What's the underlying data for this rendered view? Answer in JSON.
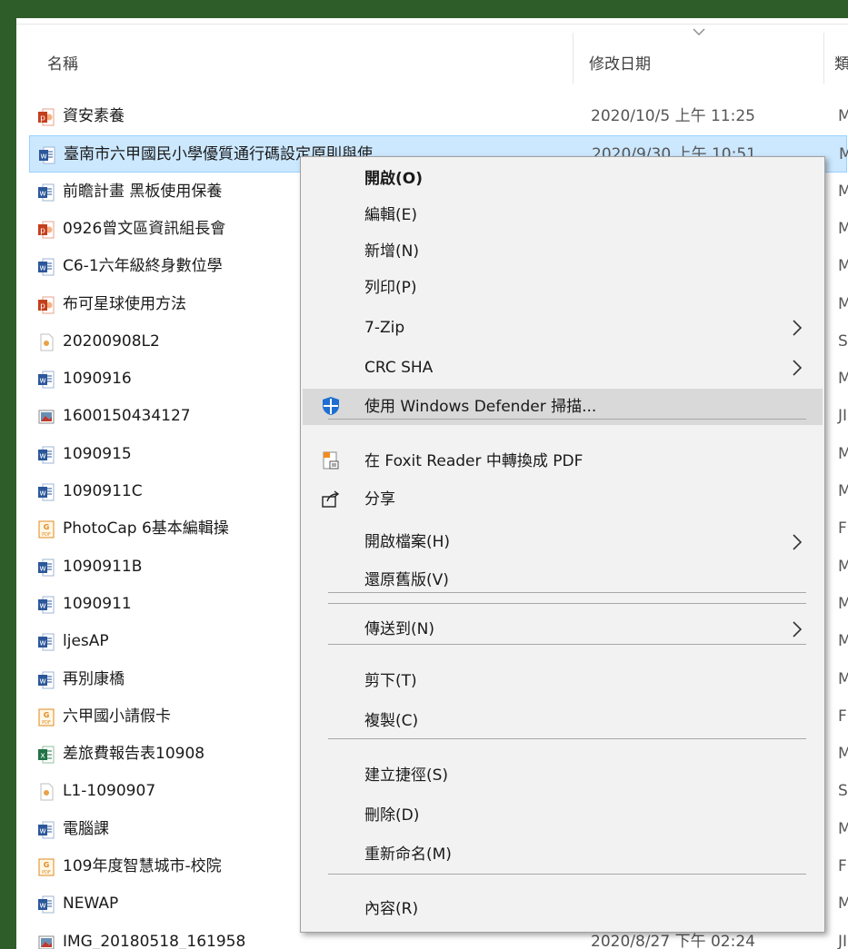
{
  "columns": {
    "name": "名稱",
    "modified": "修改日期",
    "type": "類"
  },
  "files": [
    {
      "name": "資安素養",
      "date": "2020/10/5 上午 11:25",
      "type": "M",
      "icon": "ppt-icon"
    },
    {
      "name": "臺南市六甲國民小學優質通行碼設定原則與使",
      "date": "2020/9/30 上午 10:51",
      "type": "M",
      "icon": "word-icon",
      "selected": true
    },
    {
      "name": "前瞻計畫 黑板使用保養",
      "date": "",
      "type": "M",
      "icon": "word-icon"
    },
    {
      "name": "0926曾文區資訊組長會",
      "date": "",
      "type": "M",
      "icon": "ppt-icon"
    },
    {
      "name": "C6-1六年級終身數位學",
      "date": "",
      "type": "M",
      "icon": "word-icon"
    },
    {
      "name": "布可星球使用方法",
      "date": "",
      "type": "M",
      "icon": "ppt-icon"
    },
    {
      "name": "20200908L2",
      "date": "",
      "type": "S",
      "icon": "generic-file-icon"
    },
    {
      "name": "1090916",
      "date": "",
      "type": "M",
      "icon": "word-icon"
    },
    {
      "name": "1600150434127",
      "date": "",
      "type": "JI",
      "icon": "image-icon"
    },
    {
      "name": "1090915",
      "date": "",
      "type": "M",
      "icon": "word-icon"
    },
    {
      "name": "1090911C",
      "date": "",
      "type": "M",
      "icon": "word-icon"
    },
    {
      "name": "PhotoCap 6基本編輯操",
      "date": "",
      "type": "F",
      "icon": "pdf-icon"
    },
    {
      "name": "1090911B",
      "date": "",
      "type": "M",
      "icon": "word-icon"
    },
    {
      "name": "1090911",
      "date": "",
      "type": "M",
      "icon": "word-icon"
    },
    {
      "name": "ljesAP",
      "date": "",
      "type": "M",
      "icon": "word-icon"
    },
    {
      "name": "再別康橋",
      "date": "",
      "type": "M",
      "icon": "word-icon"
    },
    {
      "name": "六甲國小請假卡",
      "date": "",
      "type": "F",
      "icon": "pdf-icon"
    },
    {
      "name": "差旅費報告表10908",
      "date": "",
      "type": "M",
      "icon": "excel-icon"
    },
    {
      "name": "L1-1090907",
      "date": "",
      "type": "S",
      "icon": "generic-file-icon"
    },
    {
      "name": "電腦課",
      "date": "",
      "type": "M",
      "icon": "word-icon"
    },
    {
      "name": "109年度智慧城市-校院",
      "date": "",
      "type": "F",
      "icon": "pdf-icon"
    },
    {
      "name": "NEWAP",
      "date": "",
      "type": "M",
      "icon": "word-icon"
    },
    {
      "name": "IMG_20180518_161958",
      "date": "2020/8/27 下午 02:24",
      "type": "JI",
      "icon": "image-icon"
    }
  ],
  "context_menu": {
    "items": [
      {
        "label": "開啟(O)",
        "bold": true
      },
      {
        "label": "編輯(E)"
      },
      {
        "label": "新增(N)"
      },
      {
        "label": "列印(P)"
      },
      {
        "label": "7-Zip",
        "submenu": true
      },
      {
        "label": "CRC SHA",
        "submenu": true
      },
      {
        "label": "使用 Windows Defender 掃描...",
        "icon": "windows-defender-shield-icon",
        "highlighted": true
      },
      {
        "label": "在 Foxit Reader 中轉換成 PDF",
        "icon": "foxit-pdf-icon"
      },
      {
        "label": "分享",
        "icon": "share-icon"
      },
      {
        "label": "開啟檔案(H)",
        "submenu": true
      },
      {
        "label": "還原舊版(V)"
      },
      {
        "label": "傳送到(N)",
        "submenu": true
      },
      {
        "label": "剪下(T)"
      },
      {
        "label": "複製(C)"
      },
      {
        "label": "建立捷徑(S)"
      },
      {
        "label": "刪除(D)"
      },
      {
        "label": "重新命名(M)"
      },
      {
        "label": "內容(R)"
      }
    ]
  },
  "colors": {
    "selection": "#cce8ff",
    "menu_bg": "#f2f2f2",
    "menu_highlight": "#d9d9d9",
    "frame": "#2f5d2a"
  }
}
